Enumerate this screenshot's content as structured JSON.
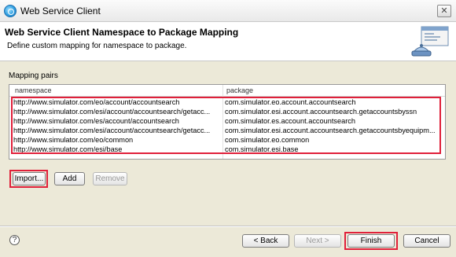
{
  "window": {
    "title": "Web Service Client",
    "close_glyph": "✕"
  },
  "banner": {
    "title": "Web Service Client Namespace to Package Mapping",
    "description": "Define custom mapping for namespace to package.",
    "icon": "wizard-window-icon"
  },
  "mapping": {
    "section_label": "Mapping pairs",
    "columns": [
      "namespace",
      "package"
    ],
    "rows": [
      {
        "namespace": "http://www.simulator.com/eo/account/accountsearch",
        "package": "com.simulator.eo.account.accountsearch"
      },
      {
        "namespace": "http://www.simulator.com/esi/account/accountsearch/getacc...",
        "package": "com.simulator.esi.account.accountsearch.getaccountsbyssn"
      },
      {
        "namespace": "http://www.simulator.com/es/account/accountsearch",
        "package": "com.simulator.es.account.accountsearch"
      },
      {
        "namespace": "http://www.simulator.com/esi/account/accountsearch/getacc...",
        "package": "com.simulator.esi.account.accountsearch.getaccountsbyequipm..."
      },
      {
        "namespace": "http://www.simulator.com/eo/common",
        "package": "com.simulator.eo.common"
      },
      {
        "namespace": "http://www.simulator.com/esi/base",
        "package": "com.simulator.esi.base"
      }
    ]
  },
  "buttons": {
    "import": "Import...",
    "add": "Add",
    "remove": "Remove",
    "back": "< Back",
    "next": "Next >",
    "finish": "Finish",
    "cancel": "Cancel",
    "help": "?"
  },
  "colors": {
    "highlight": "#e0203a",
    "dialog_bg": "#ece9d8"
  }
}
